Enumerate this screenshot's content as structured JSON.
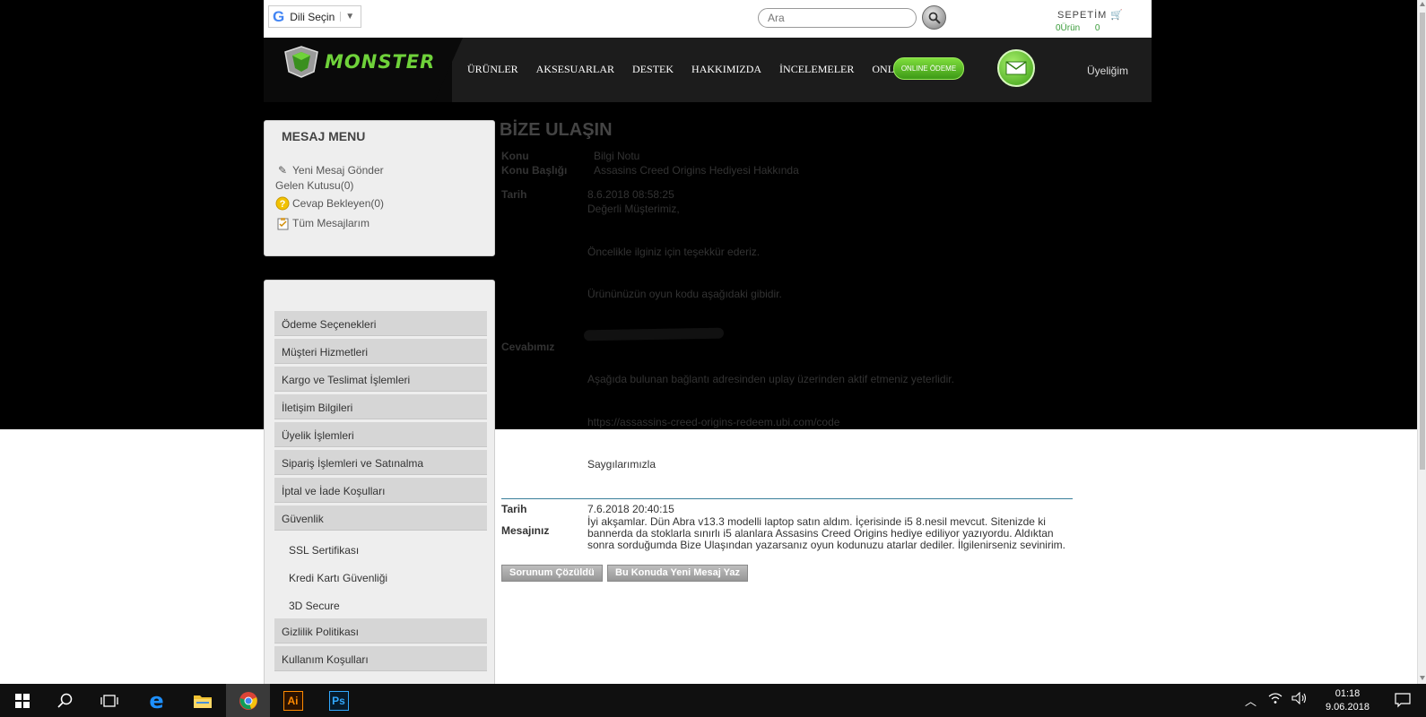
{
  "topbar": {
    "translate_label": "Dili Seçin",
    "search_placeholder": "Ara",
    "cart_title": "SEPETİM",
    "cart_count": "0Ürün",
    "cart_total": "0"
  },
  "brand": {
    "logo_text": "MONSTER",
    "accent": "#6fd23a"
  },
  "nav": {
    "items": [
      "ÜRÜNLER",
      "AKSESUARLAR",
      "DESTEK",
      "HAKKIMIZDA",
      "İNCELEMELER",
      "ONLINE SATIŞ"
    ],
    "online_payment": "ONLINE ÖDEME",
    "membership": "Üyeliğim"
  },
  "message_menu": {
    "title": "MESAJ MENU",
    "new_message": "Yeni Mesaj Gönder",
    "inbox": "Gelen Kutusu(0)",
    "awaiting": "Cevap Bekleyen(0)",
    "all_messages": "Tüm Mesajlarım"
  },
  "sidebar_links": {
    "items": [
      "Ödeme Seçenekleri",
      "Müşteri Hizmetleri",
      "Kargo ve Teslimat İşlemleri",
      "İletişim Bilgileri",
      "Üyelik İşlemleri",
      "Sipariş İşlemleri ve Satınalma",
      "İptal ve İade Koşulları",
      "Güvenlik"
    ],
    "sub_items": [
      "SSL Sertifikası",
      "Kredi Kartı Güvenliği",
      "3D Secure"
    ],
    "after": [
      "Gizlilik Politikası",
      "Kullanım Koşulları"
    ]
  },
  "content": {
    "title": "BİZE ULAŞIN",
    "subject_label": "Konu",
    "subject_value": "Bilgi Notu",
    "subject_title_label": "Konu Başlığı",
    "subject_title_value": "Assasins Creed Origins Hediyesi Hakkında",
    "date_label": "Tarih",
    "reply_date": "8.6.2018 08:58:25",
    "reply_label": "Cevabımız",
    "reply_lines": [
      "Değerli Müşterimiz,",
      "Öncelikle ilginiz için teşekkür ederiz.",
      "Ürününüzün oyun  kodu aşağıdaki gibidir.",
      "Aşağıda bulunan bağlantı adresinden uplay üzerinden aktif etmeniz yeterlidir.",
      "https://assassins-creed-origins-redeem.ubi.com/code",
      "Saygılarımızla"
    ],
    "user_date": "7.6.2018 20:40:15",
    "user_label": "Mesajınız",
    "user_message": "İyi akşamlar. Dün Abra v13.3 modelli laptop satın aldım. İçerisinde i5 8.nesil mevcut. Sitenizde ki bannerda da stoklarla sınırlı i5 alanlara Assasins Creed Origins hediye ediliyor yazıyordu. Aldıktan sonra sorduğumda Bize Ulaşından yazarsanız oyun kodunuzu atarlar dediler. İlgilenirseniz sevinirim.",
    "btn_solved": "Sorunum Çözüldü",
    "btn_new": "Bu Konuda Yeni Mesaj Yaz"
  },
  "taskbar": {
    "time": "01:18",
    "date": "9.06.2018",
    "apps": [
      "windows-start",
      "search",
      "task-view",
      "edge",
      "file-explorer",
      "chrome",
      "illustrator",
      "photoshop"
    ]
  }
}
